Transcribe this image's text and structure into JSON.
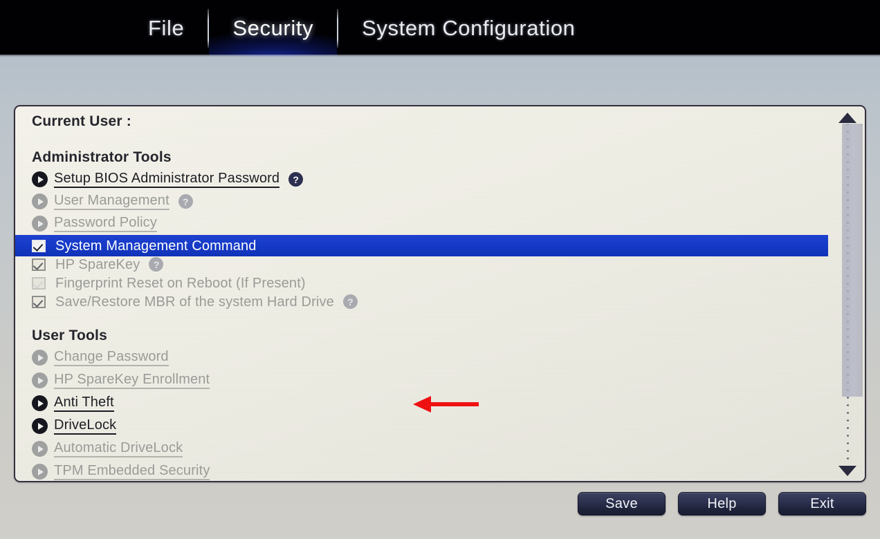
{
  "menubar": {
    "items": [
      {
        "label": "File",
        "active": false
      },
      {
        "label": "Security",
        "active": true
      },
      {
        "label": "System Configuration",
        "active": false
      }
    ]
  },
  "panel": {
    "current_user_label": "Current User :",
    "admin_section_title": "Administrator Tools",
    "user_section_title": "User Tools",
    "admin_links": [
      {
        "label": "Setup BIOS Administrator Password",
        "enabled": true,
        "help": true
      },
      {
        "label": "User Management",
        "enabled": false,
        "help": true
      },
      {
        "label": "Password Policy",
        "enabled": false,
        "help": false
      }
    ],
    "admin_checkboxes": [
      {
        "label": "System Management Command",
        "checked": true,
        "selected": true,
        "help": false,
        "faded": false
      },
      {
        "label": "HP SpareKey",
        "checked": true,
        "selected": false,
        "help": true,
        "faded": false
      },
      {
        "label": "Fingerprint Reset on Reboot (If Present)",
        "checked": false,
        "selected": false,
        "help": false,
        "faded": true
      },
      {
        "label": "Save/Restore MBR of the system Hard Drive",
        "checked": true,
        "selected": false,
        "help": true,
        "faded": false
      }
    ],
    "user_links": [
      {
        "label": "Change Password",
        "enabled": false,
        "help": false
      },
      {
        "label": "HP SpareKey Enrollment",
        "enabled": false,
        "help": false
      },
      {
        "label": "Anti Theft",
        "enabled": true,
        "help": false
      },
      {
        "label": "DriveLock",
        "enabled": true,
        "help": false
      },
      {
        "label": "Automatic DriveLock",
        "enabled": false,
        "help": false
      },
      {
        "label": "TPM Embedded Security",
        "enabled": false,
        "help": false
      }
    ],
    "help_glyph": "?"
  },
  "annotation": {
    "arrow_color": "#ee1111",
    "points_to": "Save/Restore MBR of the system Hard Drive"
  },
  "scrollbar": {
    "up_arrow": "scroll-up",
    "down_arrow": "scroll-down",
    "thumb_fraction": 0.8
  },
  "buttons": [
    {
      "label": "Save"
    },
    {
      "label": "Help"
    },
    {
      "label": "Exit"
    }
  ],
  "colors": {
    "selection_blue": "#1439c9",
    "panel_bg": "#efeee5",
    "button_navy": "#20243c"
  }
}
